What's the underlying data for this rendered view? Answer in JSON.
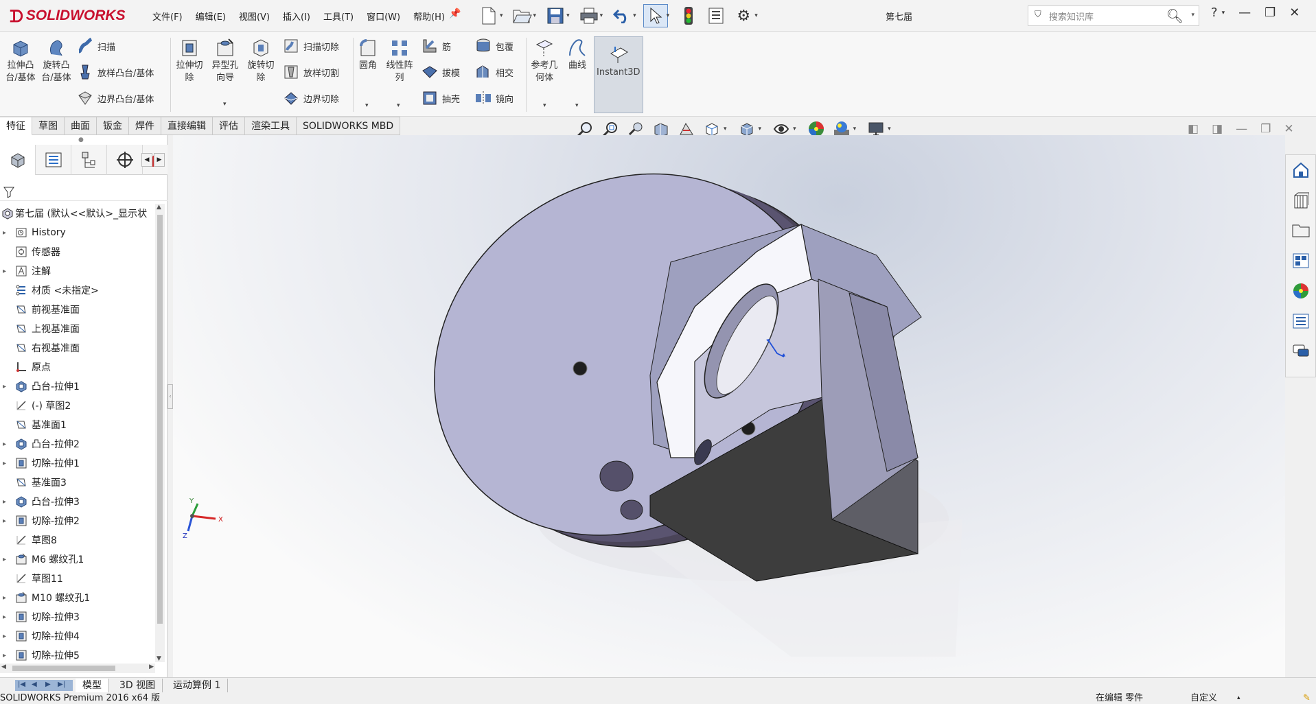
{
  "app": {
    "brand": "SOLIDWORKS",
    "doc_title": "第七届"
  },
  "menus": [
    "文件(F)",
    "编辑(E)",
    "视图(V)",
    "插入(I)",
    "工具(T)",
    "窗口(W)",
    "帮助(H)"
  ],
  "search": {
    "placeholder": "搜索知识库"
  },
  "help": "?",
  "ribbon": {
    "extrude_boss": "拉伸凸台/基体",
    "revolve_boss": "旋转凸台/基体",
    "sweep": "扫描",
    "loft_boss": "放样凸台/基体",
    "boundary_boss": "边界凸台/基体",
    "extrude_cut": "拉伸切除",
    "hole_wizard": "异型孔向导",
    "revolve_cut": "旋转切除",
    "sweep_cut": "扫描切除",
    "loft_cut": "放样切割",
    "boundary_cut": "边界切除",
    "fillet": "圆角",
    "linear_pattern": "线性阵列",
    "rib": "筋",
    "draft": "拔模",
    "shell": "抽壳",
    "wrap": "包覆",
    "intersect": "相交",
    "mirror": "镜向",
    "ref_geometry": "参考几何体",
    "curves": "曲线",
    "instant3d": "Instant3D"
  },
  "tabs": [
    "特征",
    "草图",
    "曲面",
    "钣金",
    "焊件",
    "直接编辑",
    "评估",
    "渲染工具",
    "SOLIDWORKS MBD"
  ],
  "tree": {
    "root": "第七届 (默认<<默认>_显示状",
    "items": [
      {
        "label": "History",
        "expand": true,
        "icon": "history-icon"
      },
      {
        "label": "传感器",
        "expand": false,
        "icon": "sensor-icon"
      },
      {
        "label": "注解",
        "expand": true,
        "icon": "annotation-icon"
      },
      {
        "label": "材质 <未指定>",
        "expand": false,
        "icon": "material-icon"
      },
      {
        "label": "前视基准面",
        "expand": false,
        "icon": "plane-icon"
      },
      {
        "label": "上视基准面",
        "expand": false,
        "icon": "plane-icon"
      },
      {
        "label": "右视基准面",
        "expand": false,
        "icon": "plane-icon"
      },
      {
        "label": "原点",
        "expand": false,
        "icon": "origin-icon"
      },
      {
        "label": "凸台-拉伸1",
        "expand": true,
        "icon": "boss-extrude-icon"
      },
      {
        "label": "(-) 草图2",
        "expand": false,
        "icon": "sketch-icon"
      },
      {
        "label": "基准面1",
        "expand": false,
        "icon": "plane-icon"
      },
      {
        "label": "凸台-拉伸2",
        "expand": true,
        "icon": "boss-extrude-icon"
      },
      {
        "label": "切除-拉伸1",
        "expand": true,
        "icon": "cut-extrude-icon"
      },
      {
        "label": "基准面3",
        "expand": false,
        "icon": "plane-icon"
      },
      {
        "label": "凸台-拉伸3",
        "expand": true,
        "icon": "boss-extrude-icon"
      },
      {
        "label": "切除-拉伸2",
        "expand": true,
        "icon": "cut-extrude-icon"
      },
      {
        "label": "草图8",
        "expand": false,
        "icon": "sketch-icon"
      },
      {
        "label": "M6 螺纹孔1",
        "expand": true,
        "icon": "hole-icon"
      },
      {
        "label": "草图11",
        "expand": false,
        "icon": "sketch-icon"
      },
      {
        "label": "M10 螺纹孔1",
        "expand": true,
        "icon": "hole-icon"
      },
      {
        "label": "切除-拉伸3",
        "expand": true,
        "icon": "cut-extrude-icon"
      },
      {
        "label": "切除-拉伸4",
        "expand": true,
        "icon": "cut-extrude-icon"
      },
      {
        "label": "切除-拉伸5",
        "expand": true,
        "icon": "cut-extrude-icon"
      }
    ]
  },
  "triad": {
    "x": "X",
    "y": "Y",
    "z": "Z"
  },
  "bottom_tabs": [
    "模型",
    "3D 视图",
    "运动算例 1"
  ],
  "status": {
    "left": "SOLIDWORKS Premium 2016 x64 版",
    "mode": "在编辑 零件",
    "custom": "自定义"
  },
  "colors": {
    "brand": "#c8102e",
    "accent": "#2a6fc9",
    "part_face": "#b9b9d6",
    "part_side": "#5a5470"
  }
}
